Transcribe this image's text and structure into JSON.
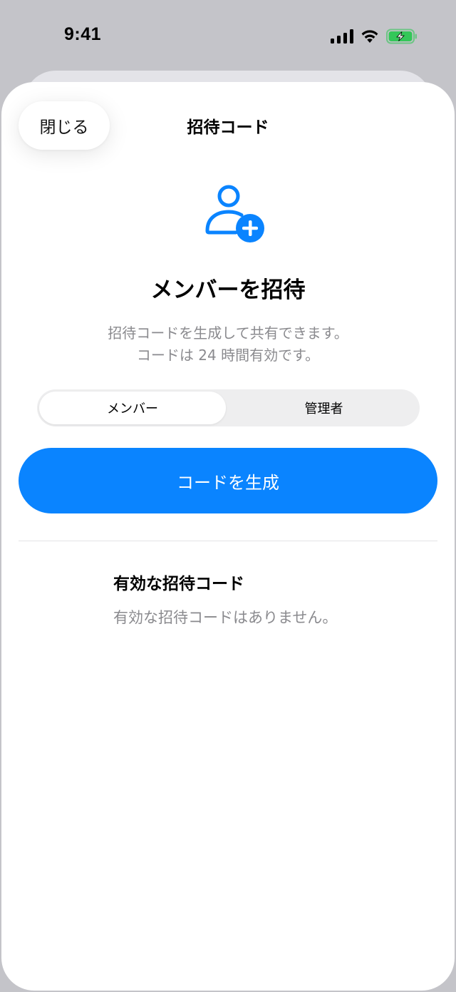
{
  "status_bar": {
    "time": "9:41",
    "icons": [
      "cellular-signal-icon",
      "wifi-icon",
      "battery-charging-icon"
    ]
  },
  "sheet": {
    "close_label": "閉じる",
    "title": "招待コード"
  },
  "hero": {
    "icon": "person-add-icon",
    "headline": "メンバーを招待",
    "description_line1": "招待コードを生成して共有できます。",
    "description_line2": "コードは 24 時間有効です。"
  },
  "role_selector": {
    "options": [
      "メンバー",
      "管理者"
    ],
    "selected": "メンバー"
  },
  "generate_button_label": "コードを生成",
  "active_codes": {
    "title": "有効な招待コード",
    "empty_message": "有効な招待コードはありません。"
  },
  "colors": {
    "accent": "#0a84ff",
    "secondary_text": "#8a8a8e",
    "battery_green": "#34c759"
  }
}
